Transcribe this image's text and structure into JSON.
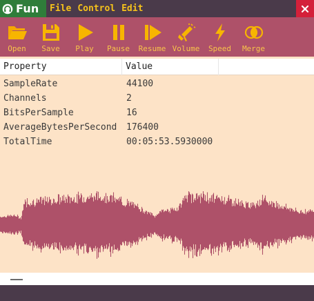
{
  "app": {
    "name": "Fun"
  },
  "menu": [
    "File",
    "Control",
    "Edit"
  ],
  "toolbar": [
    {
      "label": "Open",
      "icon": "folder-open-icon"
    },
    {
      "label": "Save",
      "icon": "save-icon"
    },
    {
      "label": "Play",
      "icon": "play-icon"
    },
    {
      "label": "Pause",
      "icon": "pause-icon"
    },
    {
      "label": "Resume",
      "icon": "resume-icon"
    },
    {
      "label": "Volume",
      "icon": "megaphone-icon"
    },
    {
      "label": "Speed",
      "icon": "lightning-icon"
    },
    {
      "label": "Merge",
      "icon": "merge-circles-icon"
    }
  ],
  "table": {
    "headers": {
      "property": "Property",
      "value": "Value"
    },
    "rows": [
      {
        "property": "SampleRate",
        "value": "44100"
      },
      {
        "property": "Channels",
        "value": "2"
      },
      {
        "property": "BitsPerSample",
        "value": "16"
      },
      {
        "property": "AverageBytesPerSecond",
        "value": "176400"
      },
      {
        "property": "TotalTime",
        "value": "00:05:53.5930000"
      }
    ]
  },
  "colors": {
    "toolbar_bg": "#ae5169",
    "accent": "#f5c21b",
    "content_bg": "#fde3c7",
    "waveform": "#ae5169",
    "brand_bg": "#2f7d3a",
    "close_bg": "#d4203a"
  }
}
